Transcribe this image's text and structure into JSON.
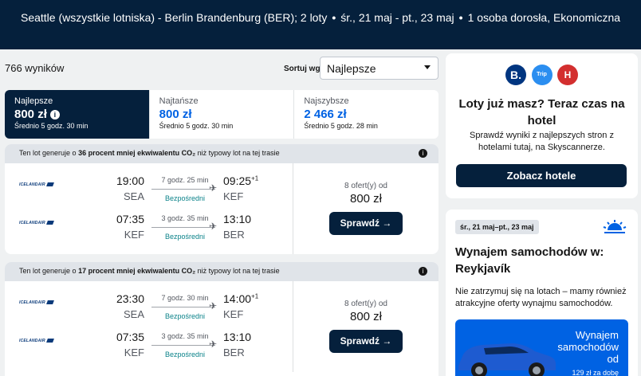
{
  "search_summary": {
    "route": "Seattle (wszystkie lotniska) - Berlin Brandenburg (BER); 2 loty",
    "dates": "śr., 21 maj - pt., 23 maj",
    "passengers": "1 osoba dorosła, Ekonomiczna"
  },
  "results": {
    "count": "766 wyników",
    "sort_label": "Sortuj wg",
    "sort_value": "Najlepsze"
  },
  "tabs": [
    {
      "label": "Najlepsze",
      "price": "800 zł",
      "sub": "Średnio 5 godz. 30 min"
    },
    {
      "label": "Najtańsze",
      "price": "800 zł",
      "sub": "Średnio 5 godz. 30 min"
    },
    {
      "label": "Najszybsze",
      "price": "2 466 zł",
      "sub": "Średnio 5 godz. 28 min"
    }
  ],
  "cards": [
    {
      "eco_pre": "Ten lot generuje o ",
      "eco_bold": "36 procent mniej ekwiwalentu CO₂",
      "eco_post": " niż typowy lot na tej trasie",
      "legs": [
        {
          "airline": "ICELANDAIR",
          "dep_time": "19:00",
          "dep_code": "SEA",
          "duration": "7 godz. 25 min",
          "stops": "Bezpośredni",
          "arr_time": "09:25",
          "arr_plus": "+1",
          "arr_code": "KEF"
        },
        {
          "airline": "ICELANDAIR",
          "dep_time": "07:35",
          "dep_code": "KEF",
          "duration": "3 godz. 35 min",
          "stops": "Bezpośredni",
          "arr_time": "13:10",
          "arr_plus": "",
          "arr_code": "BER"
        }
      ],
      "offers": "8 ofert(y) od",
      "price": "800 zł",
      "button": "Sprawdź →"
    },
    {
      "eco_pre": "Ten lot generuje o ",
      "eco_bold": "17 procent mniej ekwiwalentu CO₂",
      "eco_post": " niż typowy lot na tej trasie",
      "legs": [
        {
          "airline": "ICELANDAIR",
          "dep_time": "23:30",
          "dep_code": "SEA",
          "duration": "7 godz. 30 min",
          "stops": "Bezpośredni",
          "arr_time": "14:00",
          "arr_plus": "+1",
          "arr_code": "KEF"
        },
        {
          "airline": "ICELANDAIR",
          "dep_time": "07:35",
          "dep_code": "KEF",
          "duration": "3 godz. 35 min",
          "stops": "Bezpośredni",
          "arr_time": "13:10",
          "arr_plus": "",
          "arr_code": "BER"
        }
      ],
      "offers": "8 ofert(y) od",
      "price": "800 zł",
      "button": "Sprawdź →"
    }
  ],
  "hotel_ad": {
    "logos": [
      "B.",
      "Trip",
      "H"
    ],
    "title": "Loty już masz? Teraz czas na hotel",
    "text": "Sprawdź wyniki z najlepszych stron z hotelami tutaj, na Skyscannerze.",
    "button": "Zobacz hotele"
  },
  "car_ad": {
    "date": "śr., 21 maj–pt., 23 maj",
    "title": "Wynajem samochodów w: Reykjavík",
    "text": "Nie zatrzymuj się na lotach – mamy również atrakcyjne oferty wynajmu samochodów.",
    "promo_title": "Wynajem samochodów od",
    "promo_sub": "129 zł za dobę"
  },
  "colors": {
    "navy": "#05203c",
    "blue": "#0062e3",
    "teal": "#0c838a"
  }
}
